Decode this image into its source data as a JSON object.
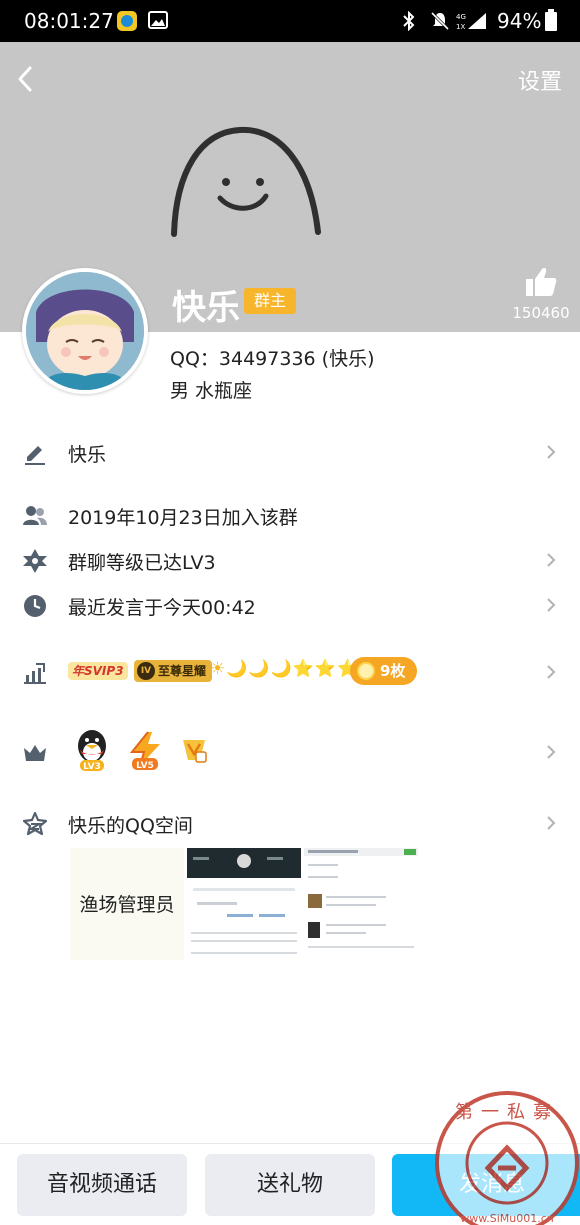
{
  "status_bar": {
    "time": "08:01:27",
    "battery": "94%"
  },
  "header": {
    "settings_label": "设置"
  },
  "profile": {
    "name": "快乐",
    "role_badge": "群主",
    "likes": "150460",
    "qq_line": "QQ：34497336 (快乐)",
    "gender_constellation": "男  水瓶座"
  },
  "rows": {
    "nickname": "快乐",
    "joined": "2019年10月23日加入该群",
    "level": "群聊等级已达LV3",
    "last_spoke": "最近发言于今天00:42",
    "svip_badge": "年SVIP3",
    "star_badge": "至尊星耀",
    "star_emblem": "IV",
    "level_icons": "☀🌙🌙🌙⭐⭐⭐",
    "coin_badge": "9枚",
    "qq_level_label": "LV3",
    "vip_level_label": "LV5",
    "space_title": "快乐的QQ空间"
  },
  "space": {
    "thumb1_text": "渔场管理员"
  },
  "bottom": {
    "call_label": "音视频通话",
    "gift_label": "送礼物",
    "msg_label": "发消息"
  },
  "watermark": {
    "text": "第一私募",
    "url": "www.SiMu001.cn"
  },
  "colors": {
    "accent": "#12b7f5",
    "owner_badge": "#f7b52c",
    "coin": "#f5a623"
  }
}
